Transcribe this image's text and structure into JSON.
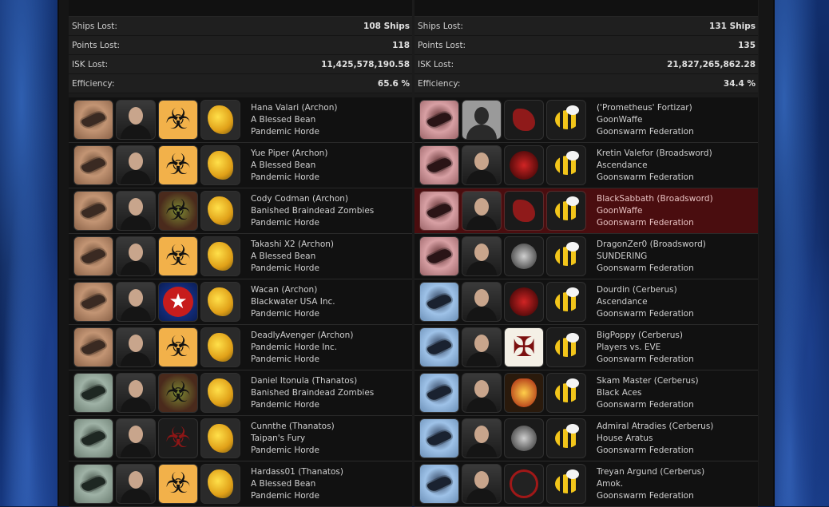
{
  "left": {
    "stats": [
      {
        "label": "Ships Lost:",
        "value": "108 Ships"
      },
      {
        "label": "Points Lost:",
        "value": "118"
      },
      {
        "label": "ISK Lost:",
        "value": "11,425,578,190.58"
      },
      {
        "label": "Efficiency:",
        "value": "65.6 %"
      }
    ],
    "rows": [
      {
        "pilot": "Hana Valari (Archon)",
        "corp": "A Blessed Bean",
        "alliance": "Pandemic Horde",
        "ship": "bronze",
        "corpIcon": "bio"
      },
      {
        "pilot": "Yue Piper (Archon)",
        "corp": "A Blessed Bean",
        "alliance": "Pandemic Horde",
        "ship": "bronze",
        "corpIcon": "bio"
      },
      {
        "pilot": "Cody Codman (Archon)",
        "corp": "Banished Braindead Zombies",
        "alliance": "Pandemic Horde",
        "ship": "bronze",
        "corpIcon": "bio-dark"
      },
      {
        "pilot": "Takashi X2 (Archon)",
        "corp": "A Blessed Bean",
        "alliance": "Pandemic Horde",
        "ship": "bronze",
        "corpIcon": "bio"
      },
      {
        "pilot": "Wacan (Archon)",
        "corp": "Blackwater USA Inc.",
        "alliance": "Pandemic Horde",
        "ship": "bronze",
        "corpIcon": "star"
      },
      {
        "pilot": "DeadlyAvenger (Archon)",
        "corp": "Pandemic Horde Inc.",
        "alliance": "Pandemic Horde",
        "ship": "bronze",
        "corpIcon": "bio"
      },
      {
        "pilot": "Daniel Itonula (Thanatos)",
        "corp": "Banished Braindead Zombies",
        "alliance": "Pandemic Horde",
        "ship": "green",
        "corpIcon": "bio-dark"
      },
      {
        "pilot": "Cunnthe (Thanatos)",
        "corp": "Taipan's Fury",
        "alliance": "Pandemic Horde",
        "ship": "green",
        "corpIcon": "bio-red"
      },
      {
        "pilot": "Hardass01 (Thanatos)",
        "corp": "A Blessed Bean",
        "alliance": "Pandemic Horde",
        "ship": "green",
        "corpIcon": "bio"
      }
    ]
  },
  "right": {
    "stats": [
      {
        "label": "Ships Lost:",
        "value": "131 Ships"
      },
      {
        "label": "Points Lost:",
        "value": "135"
      },
      {
        "label": "ISK Lost:",
        "value": "21,827,265,862.28"
      },
      {
        "label": "Efficiency:",
        "value": "34.4 %"
      }
    ],
    "rows": [
      {
        "pilot": "('Prometheus' Fortizar)",
        "corp": "GoonWaffe",
        "alliance": "Goonswarm Federation",
        "ship": "red",
        "corpIcon": "pony",
        "portrait": "silhouette"
      },
      {
        "pilot": "Kretin Valefor (Broadsword)",
        "corp": "Ascendance",
        "alliance": "Goonswarm Federation",
        "ship": "red",
        "corpIcon": "emblem-red"
      },
      {
        "pilot": "BlackSabbath (Broadsword)",
        "corp": "GoonWaffe",
        "alliance": "Goonswarm Federation",
        "ship": "red",
        "corpIcon": "pony",
        "highlight": true
      },
      {
        "pilot": "DragonZer0 (Broadsword)",
        "corp": "SUNDERING",
        "alliance": "Goonswarm Federation",
        "ship": "red",
        "corpIcon": "wings"
      },
      {
        "pilot": "Dourdin (Cerberus)",
        "corp": "Ascendance",
        "alliance": "Goonswarm Federation",
        "ship": "blue",
        "corpIcon": "emblem-red"
      },
      {
        "pilot": "BigPoppy (Cerberus)",
        "corp": "Players vs. EVE",
        "alliance": "Goonswarm Federation",
        "ship": "blue",
        "corpIcon": "cross"
      },
      {
        "pilot": "Skam Master (Cerberus)",
        "corp": "Black Aces",
        "alliance": "Goonswarm Federation",
        "ship": "blue",
        "corpIcon": "eagle"
      },
      {
        "pilot": "Admiral Atradies (Cerberus)",
        "corp": "House Aratus",
        "alliance": "Goonswarm Federation",
        "ship": "blue",
        "corpIcon": "wings"
      },
      {
        "pilot": "Treyan Argund (Cerberus)",
        "corp": "Amok.",
        "alliance": "Goonswarm Federation",
        "ship": "blue",
        "corpIcon": "skull"
      }
    ]
  },
  "icons": {
    "horde_alliance": "chicken-logo-icon",
    "goon_alliance": "bee-logo-icon",
    "biohazard": "☣",
    "star": "★",
    "cross": "✠"
  }
}
